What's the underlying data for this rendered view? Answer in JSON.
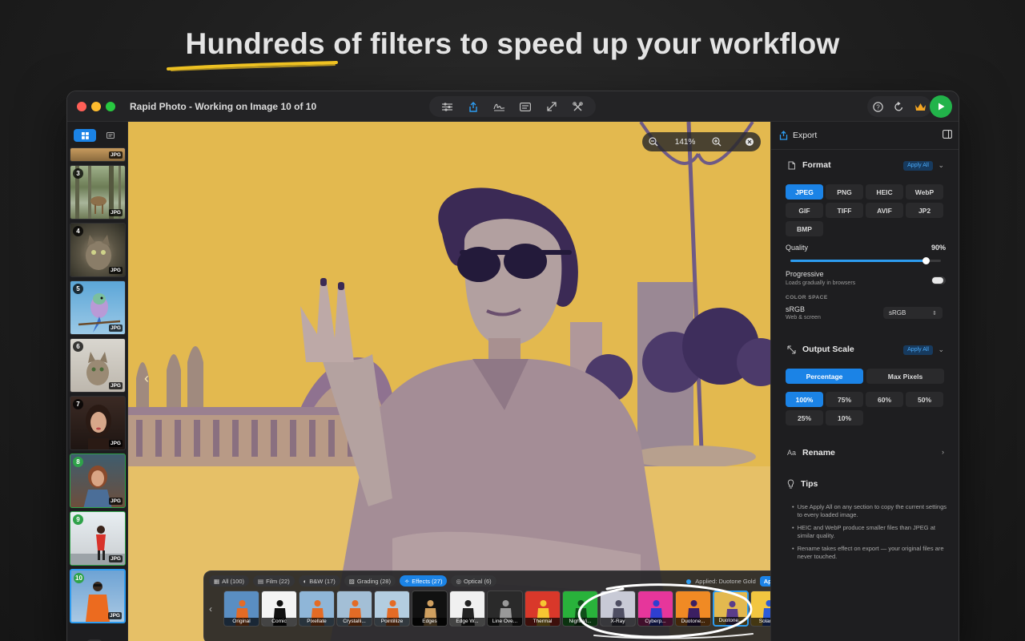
{
  "headline": "Hundreds of filters to speed up your workflow",
  "window": {
    "title": "Rapid Photo - Working on Image 10 of 10",
    "toolbar_icons": [
      "sliders-icon",
      "share-icon",
      "signature-icon",
      "caption-icon",
      "resize-icon",
      "tools-icon"
    ],
    "right_icons": [
      "help-icon",
      "refresh-icon",
      "crown-icon"
    ]
  },
  "sidebar": {
    "thumbnails": [
      {
        "num": "",
        "badge": "JPG"
      },
      {
        "num": "3",
        "badge": "JPG"
      },
      {
        "num": "4",
        "badge": "JPG"
      },
      {
        "num": "5",
        "badge": "JPG"
      },
      {
        "num": "6",
        "badge": "JPG"
      },
      {
        "num": "7",
        "badge": "JPG"
      },
      {
        "num": "8",
        "badge": "JPG"
      },
      {
        "num": "9",
        "badge": "JPG"
      },
      {
        "num": "10",
        "badge": "JPG"
      }
    ]
  },
  "canvas": {
    "zoom": "141%"
  },
  "filters": {
    "categories": [
      {
        "label": "All (100)"
      },
      {
        "label": "Film (22)"
      },
      {
        "label": "B&W (17)"
      },
      {
        "label": "Grading (28)"
      },
      {
        "label": "Effects (27)"
      },
      {
        "label": "Optical (6)"
      }
    ],
    "applied": "Applied: Duotone Gold",
    "apply_all": "Apply All",
    "items": [
      {
        "label": "Original",
        "bg": "#5a8ec2",
        "fg": "#e46b25"
      },
      {
        "label": "Comic",
        "bg": "#f4f4f4",
        "fg": "#111111"
      },
      {
        "label": "Pixellate",
        "bg": "#8fb6d8",
        "fg": "#e46b25"
      },
      {
        "label": "Crystalli...",
        "bg": "#a3bfd6",
        "fg": "#e46b25"
      },
      {
        "label": "Pointillize",
        "bg": "#b3cde0",
        "fg": "#e46b25"
      },
      {
        "label": "Edges",
        "bg": "#111111",
        "fg": "#d0a060"
      },
      {
        "label": "Edge W...",
        "bg": "#f0f0f0",
        "fg": "#222222"
      },
      {
        "label": "Line Ove...",
        "bg": "#2a2a2a",
        "fg": "#999999"
      },
      {
        "label": "Thermal",
        "bg": "#d9382a",
        "fg": "#f6c632"
      },
      {
        "label": "Night Vi...",
        "bg": "#29b23b",
        "fg": "#0f4f19"
      },
      {
        "label": "X-Ray",
        "bg": "#c8cad6",
        "fg": "#4e4e62"
      },
      {
        "label": "Cyberp...",
        "bg": "#e6369b",
        "fg": "#2e3fd0"
      },
      {
        "label": "Duotone...",
        "bg": "#f08a24",
        "fg": "#3b1f62"
      },
      {
        "label": "Duotone...",
        "bg": "#e3b94f",
        "fg": "#5a3d8a"
      },
      {
        "label": "Solarize",
        "bg": "#f2c640",
        "fg": "#2c5bd8"
      }
    ]
  },
  "panel": {
    "title": "Export",
    "format": {
      "title": "Format",
      "apply_all": "Apply All",
      "options": [
        "JPEG",
        "PNG",
        "HEIC",
        "WebP",
        "GIF",
        "TIFF",
        "AVIF",
        "JP2",
        "BMP"
      ],
      "selected": "JPEG",
      "quality_label": "Quality",
      "quality_value": "90%",
      "quality": 0.9,
      "progressive_label": "Progressive",
      "progressive_sub": "Loads gradually in browsers",
      "color_space_caps": "COLOR SPACE",
      "color_space_label": "sRGB",
      "color_space_sub": "Web & screen",
      "color_space_select": "sRGB"
    },
    "scale": {
      "title": "Output Scale",
      "apply_all": "Apply All",
      "tabs": [
        "Percentage",
        "Max Pixels"
      ],
      "options": [
        "100%",
        "75%",
        "60%",
        "50%",
        "25%",
        "10%"
      ]
    },
    "rename": {
      "title": "Rename"
    },
    "tips": {
      "title": "Tips",
      "items": [
        "Use Apply All on any section to copy the current settings to every loaded image.",
        "HEIC and WebP produce smaller files than JPEG at similar quality.",
        "Rename takes effect on export — your original files are never touched."
      ]
    }
  },
  "colors": {
    "accent": "#1b83e6",
    "duotone_bg": "#e3b94f",
    "duotone_fg": "#5a3d8a"
  }
}
